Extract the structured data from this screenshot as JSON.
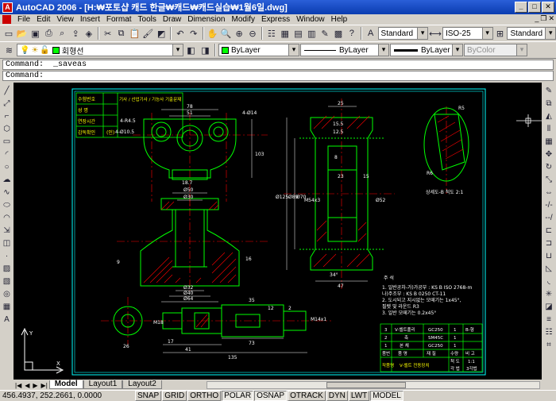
{
  "window": {
    "title": "AutoCAD 2006 - [H:₩포토샵 캐드 한글₩캐드₩캐드실습₩1월6일.dwg]",
    "app_icon": "A"
  },
  "menu": [
    "File",
    "Edit",
    "View",
    "Insert",
    "Format",
    "Tools",
    "Draw",
    "Dimension",
    "Modify",
    "Express",
    "Window",
    "Help"
  ],
  "toolbar_styles": {
    "text_style": "Standard",
    "dim_style": "ISO-25",
    "table_style": "Standard"
  },
  "layers": {
    "current_layer": "회형선",
    "color": "ByLayer",
    "linetype": "ByLayer",
    "lineweight": "ByLayer",
    "plotstyle": "ByColor"
  },
  "command": {
    "history": "Command:  _saveas",
    "prompt": "Command:"
  },
  "tabs": [
    "Model",
    "Layout1",
    "Layout2"
  ],
  "status": {
    "coords": "456.4937, 252.2661, 0.0000",
    "toggles": [
      "SNAP",
      "GRID",
      "ORTHO",
      "POLAR",
      "OSNAP",
      "OTRACK",
      "DYN",
      "LWT",
      "MODEL"
    ]
  },
  "drawing": {
    "title_block": [
      "수험번호",
      "성   명",
      "연장시간",
      "감독확인",
      "(인)"
    ],
    "title_header": "기사 / 산업기사 / 기능사 기출문제",
    "view_label": "상세도-B 척도 2:1",
    "notes_title": "주 석",
    "notes": [
      "1. 일반공차-가)가공부 : KS B ISO 2768-m",
      "   나)주조부 : KS B 0250 CT-11",
      "2. 도시되고 지시없는 모떼기는 1x45°,",
      "   필렛 및 라운드 R3",
      "3. 일반 모떼기는 0.2x45°"
    ],
    "parts_rows": [
      [
        "3",
        "V-벨트풀리",
        "GC250",
        "1",
        "B-형"
      ],
      [
        "2",
        "축",
        "SM45C",
        "1",
        ""
      ],
      [
        "1",
        "본 체",
        "GC250",
        "1",
        ""
      ],
      [
        "품번",
        "품    명",
        "재  질",
        "수량",
        "비 고"
      ]
    ],
    "parts_footer": {
      "label": "작품명",
      "name": "V-벨트 전동장치",
      "scale_label": "척 도",
      "scale": "1:1",
      "proj_label": "각 법",
      "proj": "3각법"
    },
    "dims": [
      "78",
      "51",
      "4-R4.5",
      "4-Ø10.5",
      "4-Ø14",
      "18.7",
      "103",
      "Ø50",
      "Ø30",
      "9",
      "Ø32",
      "Ø40",
      "Ø64",
      "16",
      "25",
      "15.5",
      "12.5",
      "Ø125",
      "Ø89",
      "Ø70",
      "M54x3",
      "Ø52",
      "8",
      "23",
      "15",
      "47",
      "34°",
      "R6",
      "R5",
      "M18",
      "26",
      "17",
      "41",
      "135",
      "73",
      "M14x1",
      "35",
      "12",
      "2"
    ]
  },
  "colors": {
    "border": "#00ffff",
    "outline": "#00ff00",
    "hatch": "#ff0000",
    "dim": "#ffffff",
    "text": "#ffff00",
    "center": "#ff0000"
  }
}
